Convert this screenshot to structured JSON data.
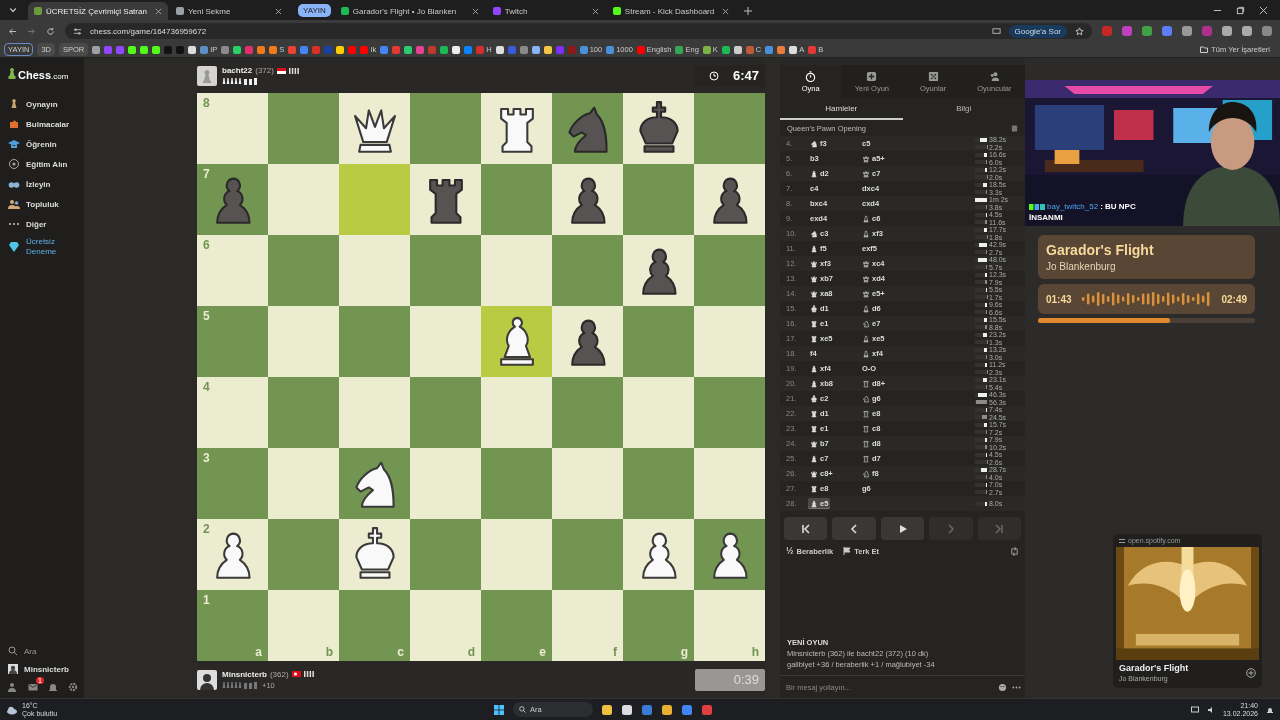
{
  "browser": {
    "tabs": [
      {
        "title": "ÜCRETSİZ Çevrimiçi Satran",
        "selected": true,
        "color": "#6a9a3a"
      },
      {
        "title": "Yeni Sekme",
        "selected": false,
        "color": "#9aa0a6"
      },
      {
        "title": "Garador's Flight • Jo Blanken",
        "selected": false,
        "color": "#1db954",
        "group": "YAYIN"
      },
      {
        "title": "Twitch",
        "selected": false,
        "color": "#9146ff"
      },
      {
        "title": "Stream - Kick Dashboard",
        "selected": false,
        "color": "#53fc18"
      }
    ],
    "url": "chess.com/game/164736959672",
    "ask_button": "Google'a Sor",
    "all_bookmarks": "Tüm Yer İşaretleri",
    "bookmarks": [
      {
        "kind": "chip",
        "label": "YAYIN"
      },
      {
        "kind": "chip",
        "label": "3D"
      },
      {
        "kind": "chip",
        "label": "SPOR"
      },
      {
        "kind": "icon",
        "color": "#9aa0a6"
      },
      {
        "kind": "icon",
        "color": "#9146ff"
      },
      {
        "kind": "icon",
        "color": "#9146ff"
      },
      {
        "kind": "icon",
        "color": "#53fc18"
      },
      {
        "kind": "icon",
        "color": "#53fc18"
      },
      {
        "kind": "icon",
        "color": "#53fc18"
      },
      {
        "kind": "icon",
        "color": "#111111"
      },
      {
        "kind": "icon",
        "color": "#111111"
      },
      {
        "kind": "icon",
        "color": "#dddddd"
      },
      {
        "kind": "icon",
        "color": "#5b8fc7",
        "label": "IP"
      },
      {
        "kind": "icon",
        "color": "#8a8a8a"
      },
      {
        "kind": "icon",
        "color": "#25d366"
      },
      {
        "kind": "icon",
        "color": "#e1306c"
      },
      {
        "kind": "icon",
        "color": "#f27a1a"
      },
      {
        "kind": "icon",
        "color": "#f27a1a",
        "label": "S"
      },
      {
        "kind": "icon",
        "color": "#ea4335"
      },
      {
        "kind": "icon",
        "color": "#4285f4"
      },
      {
        "kind": "icon",
        "color": "#d93025"
      },
      {
        "kind": "icon",
        "color": "#1a3fa0"
      },
      {
        "kind": "icon",
        "color": "#ffcc00"
      },
      {
        "kind": "icon",
        "color": "#ff0000"
      },
      {
        "kind": "icon",
        "color": "#ff0000",
        "label": "Ik"
      },
      {
        "kind": "icon",
        "color": "#4285f4"
      },
      {
        "kind": "icon",
        "color": "#e53935"
      },
      {
        "kind": "icon",
        "color": "#2ecc71"
      },
      {
        "kind": "icon",
        "color": "#e84393"
      },
      {
        "kind": "icon",
        "color": "#c0392b"
      },
      {
        "kind": "icon",
        "color": "#1db954"
      },
      {
        "kind": "icon",
        "color": "#eeeeee"
      },
      {
        "kind": "icon",
        "color": "#0a84ff"
      },
      {
        "kind": "icon",
        "color": "#d32f2f",
        "label": "H"
      },
      {
        "kind": "icon",
        "color": "#dddddd"
      },
      {
        "kind": "icon",
        "color": "#3b5bdb"
      },
      {
        "kind": "icon",
        "color": "#8a8a8a"
      },
      {
        "kind": "icon",
        "color": "#8ab4f8"
      },
      {
        "kind": "icon",
        "color": "#f5c542"
      },
      {
        "kind": "icon",
        "color": "#7b2ff7"
      },
      {
        "kind": "icon",
        "color": "#8b1a1a"
      },
      {
        "kind": "icon",
        "color": "#4a90d9",
        "label": "100"
      },
      {
        "kind": "icon",
        "color": "#4a90d9",
        "label": "1000"
      },
      {
        "kind": "icon",
        "color": "#ff0000",
        "label": "English"
      },
      {
        "kind": "icon",
        "color": "#34a853",
        "label": "Eng"
      },
      {
        "kind": "icon",
        "color": "#7cb342",
        "label": "K"
      },
      {
        "kind": "icon",
        "color": "#1db954"
      },
      {
        "kind": "icon",
        "color": "#cccccc"
      },
      {
        "kind": "icon",
        "color": "#c0583a",
        "label": "C"
      },
      {
        "kind": "icon",
        "color": "#4a90d9"
      },
      {
        "kind": "icon",
        "color": "#e87d3e"
      },
      {
        "kind": "icon",
        "color": "#dddddd",
        "label": "A"
      },
      {
        "kind": "icon",
        "color": "#e53935",
        "label": "B"
      }
    ]
  },
  "sidebar": {
    "logo": "Chess",
    "logo_suffix": ".com",
    "items": [
      {
        "label": "Oynayın",
        "kind": "normal"
      },
      {
        "label": "Bulmacalar",
        "kind": "normal"
      },
      {
        "label": "Öğrenin",
        "kind": "normal"
      },
      {
        "label": "Eğitim Alın",
        "kind": "normal"
      },
      {
        "label": "İzleyin",
        "kind": "normal"
      },
      {
        "label": "Topluluk",
        "kind": "normal"
      },
      {
        "label": "Diğer",
        "kind": "normal"
      },
      {
        "label": "Ücretsiz Deneme",
        "kind": "promo"
      }
    ],
    "search": "Ara",
    "user": "Minsnicterb",
    "messages_badge": "1"
  },
  "top_player": {
    "name": "bacht22",
    "rating": "(372)",
    "clock": "6:47",
    "running": true
  },
  "bottom_player": {
    "name": "Minsnicterb",
    "rating": "(362)",
    "advantage": "+10",
    "clock": "0:39",
    "running": false
  },
  "board": {
    "rank_labels": [
      "8",
      "7",
      "6",
      "5",
      "4",
      "3",
      "2",
      "1"
    ],
    "file_labels": [
      "a",
      "b",
      "c",
      "d",
      "e",
      "f",
      "g",
      "h"
    ],
    "rows": [
      [
        {
          "kind": "empty",
          "highlighted": false
        },
        {
          "kind": "empty",
          "highlighted": false
        },
        {
          "kind": "white-queen",
          "highlighted": false
        },
        {
          "kind": "empty",
          "highlighted": false
        },
        {
          "kind": "white-rook",
          "highlighted": false
        },
        {
          "kind": "black-knight",
          "highlighted": false
        },
        {
          "kind": "black-king",
          "highlighted": false
        },
        {
          "kind": "empty",
          "highlighted": false
        }
      ],
      [
        {
          "kind": "black-pawn",
          "highlighted": false
        },
        {
          "kind": "empty",
          "highlighted": false
        },
        {
          "kind": "empty",
          "highlighted": true
        },
        {
          "kind": "black-rook",
          "highlighted": false
        },
        {
          "kind": "empty",
          "highlighted": false
        },
        {
          "kind": "black-pawn",
          "highlighted": false
        },
        {
          "kind": "empty",
          "highlighted": false
        },
        {
          "kind": "black-pawn",
          "highlighted": false
        }
      ],
      [
        {
          "kind": "empty",
          "highlighted": false
        },
        {
          "kind": "empty",
          "highlighted": false
        },
        {
          "kind": "empty",
          "highlighted": false
        },
        {
          "kind": "empty",
          "highlighted": false
        },
        {
          "kind": "empty",
          "highlighted": false
        },
        {
          "kind": "empty",
          "highlighted": false
        },
        {
          "kind": "black-pawn",
          "highlighted": false
        },
        {
          "kind": "empty",
          "highlighted": false
        }
      ],
      [
        {
          "kind": "empty",
          "highlighted": false
        },
        {
          "kind": "empty",
          "highlighted": false
        },
        {
          "kind": "empty",
          "highlighted": false
        },
        {
          "kind": "empty",
          "highlighted": false
        },
        {
          "kind": "white-bishop",
          "highlighted": true
        },
        {
          "kind": "black-pawn",
          "highlighted": false
        },
        {
          "kind": "empty",
          "highlighted": false
        },
        {
          "kind": "empty",
          "highlighted": false
        }
      ],
      [
        {
          "kind": "empty",
          "highlighted": false
        },
        {
          "kind": "empty",
          "highlighted": false
        },
        {
          "kind": "empty",
          "highlighted": false
        },
        {
          "kind": "empty",
          "highlighted": false
        },
        {
          "kind": "empty",
          "highlighted": false
        },
        {
          "kind": "empty",
          "highlighted": false
        },
        {
          "kind": "empty",
          "highlighted": false
        },
        {
          "kind": "empty",
          "highlighted": false
        }
      ],
      [
        {
          "kind": "empty",
          "highlighted": false
        },
        {
          "kind": "empty",
          "highlighted": false
        },
        {
          "kind": "white-knight",
          "highlighted": false
        },
        {
          "kind": "empty",
          "highlighted": false
        },
        {
          "kind": "empty",
          "highlighted": false
        },
        {
          "kind": "empty",
          "highlighted": false
        },
        {
          "kind": "empty",
          "highlighted": false
        },
        {
          "kind": "empty",
          "highlighted": false
        }
      ],
      [
        {
          "kind": "white-pawn",
          "highlighted": false
        },
        {
          "kind": "empty",
          "highlighted": false
        },
        {
          "kind": "white-king",
          "highlighted": false
        },
        {
          "kind": "empty",
          "highlighted": false
        },
        {
          "kind": "empty",
          "highlighted": false
        },
        {
          "kind": "empty",
          "highlighted": false
        },
        {
          "kind": "white-pawn",
          "highlighted": false
        },
        {
          "kind": "white-pawn",
          "highlighted": false
        }
      ],
      [
        {
          "kind": "empty",
          "highlighted": false
        },
        {
          "kind": "empty",
          "highlighted": false
        },
        {
          "kind": "empty",
          "highlighted": false
        },
        {
          "kind": "empty",
          "highlighted": false
        },
        {
          "kind": "empty",
          "highlighted": false
        },
        {
          "kind": "empty",
          "highlighted": false
        },
        {
          "kind": "empty",
          "highlighted": false
        },
        {
          "kind": "empty",
          "highlighted": false
        }
      ]
    ]
  },
  "panel": {
    "nav": [
      {
        "label": "Oyna",
        "selected": true
      },
      {
        "label": "Yeni Oyun",
        "selected": false
      },
      {
        "label": "Oyunlar",
        "selected": false
      },
      {
        "label": "Oyuncular",
        "selected": false
      }
    ],
    "subtabs": [
      {
        "label": "Hamleler",
        "selected": true
      },
      {
        "label": "Bilgi",
        "selected": false
      }
    ],
    "opening": "Queen's Pawn Opening",
    "moves": [
      {
        "number": "4.",
        "white": {
          "kind": "knight",
          "san": "f3",
          "selected": false
        },
        "black": {
          "kind": "pawn",
          "san": "c5",
          "selected": false
        },
        "times": [
          {
            "time": "38.2s",
            "level": 0.6
          },
          {
            "time": "2.2s",
            "level": 0.04
          }
        ]
      },
      {
        "number": "5.",
        "white": {
          "kind": "pawn",
          "san": "b3",
          "selected": false
        },
        "black": {
          "kind": "queen",
          "san": "a5+",
          "selected": false
        },
        "times": [
          {
            "time": "16.6s",
            "level": 0.27
          },
          {
            "time": "6.0s",
            "level": 0.1
          }
        ]
      },
      {
        "number": "6.",
        "white": {
          "kind": "bishop",
          "san": "d2",
          "selected": false
        },
        "black": {
          "kind": "queen",
          "san": "c7",
          "selected": false
        },
        "times": [
          {
            "time": "12.2s",
            "level": 0.2
          },
          {
            "time": "2.0s",
            "level": 0.04
          }
        ]
      },
      {
        "number": "7.",
        "white": {
          "kind": "pawn",
          "san": "c4",
          "selected": false
        },
        "black": {
          "kind": "pawn",
          "san": "dxc4",
          "selected": false
        },
        "times": [
          {
            "time": "18.5s",
            "level": 0.3
          },
          {
            "time": "3.3s",
            "level": 0.06
          }
        ]
      },
      {
        "number": "8.",
        "white": {
          "kind": "pawn",
          "san": "bxc4",
          "selected": false
        },
        "black": {
          "kind": "pawn",
          "san": "cxd4",
          "selected": false
        },
        "times": [
          {
            "time": "1m 2s",
            "level": 1
          },
          {
            "time": "3.8s",
            "level": 0.06
          }
        ]
      },
      {
        "number": "9.",
        "white": {
          "kind": "pawn",
          "san": "exd4",
          "selected": false
        },
        "black": {
          "kind": "bishop",
          "san": "c6",
          "selected": false
        },
        "times": [
          {
            "time": "4.5s",
            "level": 0.08
          },
          {
            "time": "11.6s",
            "level": 0.19
          }
        ]
      },
      {
        "number": "10.",
        "white": {
          "kind": "knight",
          "san": "c3",
          "selected": false
        },
        "black": {
          "kind": "bishop",
          "san": "xf3",
          "selected": false
        },
        "times": [
          {
            "time": "17.7s",
            "level": 0.29
          },
          {
            "time": "1.8s",
            "level": 0.03
          }
        ]
      },
      {
        "number": "11.",
        "white": {
          "kind": "bishop",
          "san": "f5",
          "selected": false
        },
        "black": {
          "kind": "pawn",
          "san": "exf5",
          "selected": false
        },
        "times": [
          {
            "time": "42.9s",
            "level": 0.69
          },
          {
            "time": "2.7s",
            "level": 0.05
          }
        ]
      },
      {
        "number": "12.",
        "white": {
          "kind": "queen",
          "san": "xf3",
          "selected": false
        },
        "black": {
          "kind": "queen",
          "san": "xc4",
          "selected": false
        },
        "times": [
          {
            "time": "48.0s",
            "level": 0.77
          },
          {
            "time": "5.7s",
            "level": 0.09
          }
        ]
      },
      {
        "number": "13.",
        "white": {
          "kind": "queen",
          "san": "xb7",
          "selected": false
        },
        "black": {
          "kind": "queen",
          "san": "xd4",
          "selected": false
        },
        "times": [
          {
            "time": "12.3s",
            "level": 0.2
          },
          {
            "time": "7.9s",
            "level": 0.13
          }
        ]
      },
      {
        "number": "14.",
        "white": {
          "kind": "queen",
          "san": "xa8",
          "selected": false
        },
        "black": {
          "kind": "queen",
          "san": "e5+",
          "selected": false
        },
        "times": [
          {
            "time": "5.5s",
            "level": 0.09
          },
          {
            "time": "1.7s",
            "level": 0.03
          }
        ]
      },
      {
        "number": "15.",
        "white": {
          "kind": "king",
          "san": "d1",
          "selected": false
        },
        "black": {
          "kind": "bishop",
          "san": "d6",
          "selected": false
        },
        "times": [
          {
            "time": "9.6s",
            "level": 0.15
          },
          {
            "time": "6.6s",
            "level": 0.11
          }
        ]
      },
      {
        "number": "16.",
        "white": {
          "kind": "rook",
          "san": "e1",
          "selected": false
        },
        "black": {
          "kind": "knight",
          "san": "e7",
          "selected": false
        },
        "times": [
          {
            "time": "15.5s",
            "level": 0.25
          },
          {
            "time": "8.8s",
            "level": 0.14
          }
        ]
      },
      {
        "number": "17.",
        "white": {
          "kind": "rook",
          "san": "xe5",
          "selected": false
        },
        "black": {
          "kind": "bishop",
          "san": "xe5",
          "selected": false
        },
        "times": [
          {
            "time": "23.2s",
            "level": 0.37
          },
          {
            "time": "1.3s",
            "level": 0.02
          }
        ]
      },
      {
        "number": "18.",
        "white": {
          "kind": "pawn",
          "san": "f4",
          "selected": false
        },
        "black": {
          "kind": "bishop",
          "san": "xf4",
          "selected": false
        },
        "times": [
          {
            "time": "13.2s",
            "level": 0.21
          },
          {
            "time": "3.0s",
            "level": 0.05
          }
        ]
      },
      {
        "number": "19.",
        "white": {
          "kind": "bishop",
          "san": "xf4",
          "selected": false
        },
        "black": {
          "kind": "castle",
          "san": "O-O",
          "selected": false
        },
        "times": [
          {
            "time": "11.2s",
            "level": 0.18
          },
          {
            "time": "2.3s",
            "level": 0.04
          }
        ]
      },
      {
        "number": "20.",
        "white": {
          "kind": "bishop",
          "san": "xb8",
          "selected": false
        },
        "black": {
          "kind": "rook",
          "san": "d8+",
          "selected": false
        },
        "times": [
          {
            "time": "23.1s",
            "level": 0.37
          },
          {
            "time": "5.4s",
            "level": 0.09
          }
        ]
      },
      {
        "number": "21.",
        "white": {
          "kind": "king",
          "san": "c2",
          "selected": false
        },
        "black": {
          "kind": "knight",
          "san": "g6",
          "selected": false
        },
        "times": [
          {
            "time": "46.3s",
            "level": 0.75
          },
          {
            "time": "56.3s",
            "level": 0.91
          }
        ]
      },
      {
        "number": "22.",
        "white": {
          "kind": "rook",
          "san": "d1",
          "selected": false
        },
        "black": {
          "kind": "rook",
          "san": "e8",
          "selected": false
        },
        "times": [
          {
            "time": "7.4s",
            "level": 0.12
          },
          {
            "time": "24.5s",
            "level": 0.4
          }
        ]
      },
      {
        "number": "23.",
        "white": {
          "kind": "rook",
          "san": "e1",
          "selected": false
        },
        "black": {
          "kind": "rook",
          "san": "c8",
          "selected": false
        },
        "times": [
          {
            "time": "15.7s",
            "level": 0.25
          },
          {
            "time": "7.2s",
            "level": 0.12
          }
        ]
      },
      {
        "number": "24.",
        "white": {
          "kind": "queen",
          "san": "b7",
          "selected": false
        },
        "black": {
          "kind": "rook",
          "san": "d8",
          "selected": false
        },
        "times": [
          {
            "time": "7.9s",
            "level": 0.13
          },
          {
            "time": "10.2s",
            "level": 0.16
          }
        ]
      },
      {
        "number": "25.",
        "white": {
          "kind": "bishop",
          "san": "c7",
          "selected": false
        },
        "black": {
          "kind": "rook",
          "san": "d7",
          "selected": false
        },
        "times": [
          {
            "time": "4.5s",
            "level": 0.08
          },
          {
            "time": "2.6s",
            "level": 0.04
          }
        ]
      },
      {
        "number": "26.",
        "white": {
          "kind": "queen",
          "san": "c8+",
          "selected": false
        },
        "black": {
          "kind": "knight",
          "san": "f8",
          "selected": false
        },
        "times": [
          {
            "time": "28.7s",
            "level": 0.46
          },
          {
            "time": "4.0s",
            "level": 0.06
          }
        ]
      },
      {
        "number": "27.",
        "white": {
          "kind": "rook",
          "san": "e8",
          "selected": false
        },
        "black": {
          "kind": "pawn",
          "san": "g6",
          "selected": false
        },
        "times": [
          {
            "time": "7.0s",
            "level": 0.11
          },
          {
            "time": "2.7s",
            "level": 0.05
          }
        ]
      },
      {
        "number": "28.",
        "white": {
          "kind": "bishop",
          "san": "e5",
          "selected": true
        },
        "times": [
          {
            "time": "8.0s",
            "level": 0.13
          }
        ]
      }
    ],
    "controls": [
      {
        "disabled": false
      },
      {
        "disabled": false
      },
      {
        "disabled": false
      },
      {
        "disabled": true
      },
      {
        "disabled": true
      }
    ],
    "actions": [
      {
        "icon": "½",
        "label": "Beraberlik"
      },
      {
        "label": "Terk Et"
      }
    ],
    "chat": {
      "title": "YENİ OYUN",
      "lines": [
        "Minsnicterb (362) ile bacht22 (372) (10 dk)",
        "galibiyet +36 / beraberlik +1 / mağlubiyet -34"
      ],
      "placeholder": "Bir mesaj yollayın..."
    }
  },
  "stream": {
    "chat_user": "bay_twitch_52",
    "chat_message": ": BU NPC",
    "chat_message_2": "İNSANMI",
    "track": {
      "title": "Garador's Flight",
      "artist": "Jo Blankenburg",
      "elapsed": "01:43",
      "total": "02:49",
      "level": 0.61
    },
    "mini_player": {
      "site": "open.spotify.com",
      "title": "Garador's Flight",
      "artist": "Jo Blankenburg"
    }
  },
  "taskbar": {
    "temperature": "16°C",
    "weather": "Çok bulutlu",
    "search": "Ara",
    "time": "21:40",
    "date": "13.02.2026"
  }
}
